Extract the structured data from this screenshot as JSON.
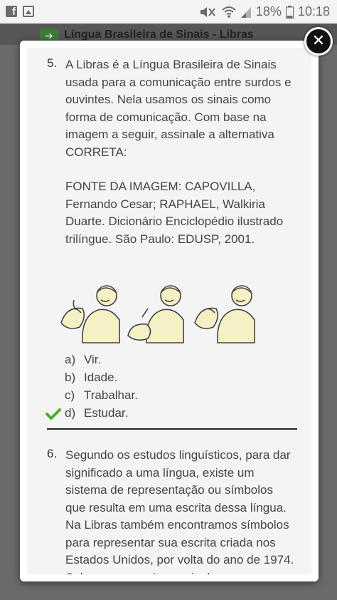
{
  "status_bar": {
    "battery": "18%",
    "time": "10:18",
    "icons": [
      "facebook-icon",
      "gallery-icon",
      "mute-icon",
      "wifi-icon",
      "signal-icon",
      "battery-icon"
    ]
  },
  "background": {
    "title": "Língua Brasileira de Sinais - Libras"
  },
  "close_label": "✕",
  "question5": {
    "number": "5.",
    "text": "A Libras é a Língua Brasileira de Sinais usada para a comunicação entre surdos e ouvintes. Nela usamos os sinais como forma de comunicação. Com base na imagem a seguir, assinale a alternativa CORRETA:",
    "source": "FONTE DA IMAGEM: CAPOVILLA, Fernando Cesar; RAPHAEL, Walkiria Duarte. Dicionário Enciclopédio ilustrado trilíngue. São Paulo: EDUSP, 2001.",
    "options": [
      {
        "letter": "a)",
        "text": "Vir.",
        "correct": false
      },
      {
        "letter": "b)",
        "text": "Idade.",
        "correct": false
      },
      {
        "letter": "c)",
        "text": "Trabalhar.",
        "correct": false
      },
      {
        "letter": "d)",
        "text": "Estudar.",
        "correct": true
      }
    ]
  },
  "question6": {
    "number": "6.",
    "text": "Segundo os estudos linguísticos, para dar significado a uma língua, existe um sistema de representação ou símbolos que resulta em uma escrita dessa língua. Na Libras também encontramos símbolos para representar sua escrita criada nos Estados Unidos, por volta do ano de 1974. Sobre essa escrita, assinale"
  },
  "colors": {
    "check_green": "#4caf2f",
    "figure_skin": "#f6f1c4"
  }
}
